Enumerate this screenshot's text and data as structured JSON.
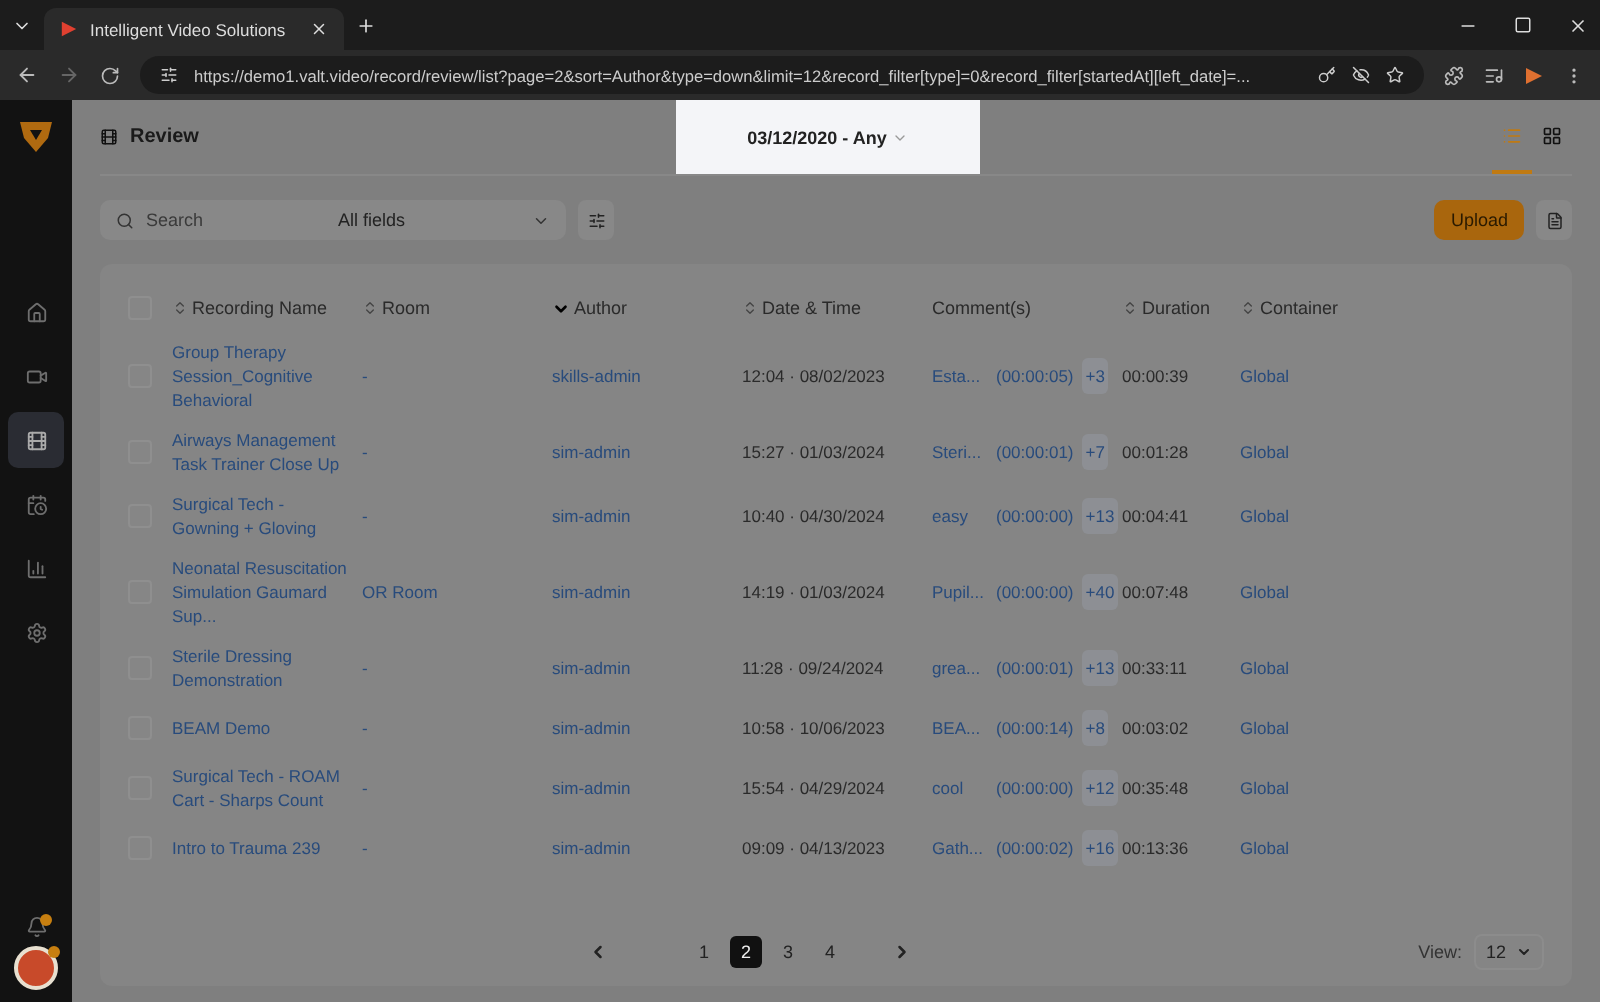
{
  "browser": {
    "tab_title": "Intelligent Video Solutions",
    "url": "https://demo1.valt.video/record/review/list?page=2&sort=Author&type=down&limit=12&record_filter[type]=0&record_filter[startedAt][left_date]=..."
  },
  "sidebar": {
    "items": [
      {
        "selected": false
      },
      {
        "selected": false
      },
      {
        "selected": true
      },
      {
        "selected": false
      },
      {
        "selected": false
      },
      {
        "selected": false
      }
    ],
    "notifications_unread": true,
    "avatar_badge": true
  },
  "header": {
    "title": "Review",
    "date_range": "03/12/2020 - Any",
    "view_buttons": [
      {
        "selected": true
      },
      {
        "selected": false
      }
    ]
  },
  "toolbar": {
    "search_placeholder": "Search",
    "field_select": "All fields",
    "upload": "Upload"
  },
  "table": {
    "select_all_checked": false,
    "columns": [
      {
        "label": "Recording Name",
        "sortable": true,
        "sorted": false
      },
      {
        "label": "Room",
        "sortable": true,
        "sorted": false
      },
      {
        "label": "Author",
        "sortable": true,
        "sorted": true
      },
      {
        "label": "Date & Time",
        "sortable": true,
        "sorted": false
      },
      {
        "label": "Comment(s)",
        "sortable": false,
        "sorted": false
      },
      {
        "label": "Duration",
        "sortable": true,
        "sorted": false
      },
      {
        "label": "Container",
        "sortable": true,
        "sorted": false
      }
    ],
    "rows": [
      {
        "checked": false,
        "name": "Group Therapy Session_Cognitive Behavioral",
        "room": "-",
        "author": "skills-admin",
        "datetime": "12:04 · 08/02/2023",
        "comment": "Esta...",
        "comment_time": "(00:00:05)",
        "more": "+3",
        "duration": "00:00:39",
        "container": "Global"
      },
      {
        "checked": false,
        "name": "Airways Management Task Trainer Close Up",
        "room": "-",
        "author": "sim-admin",
        "datetime": "15:27 · 01/03/2024",
        "comment": "Steri...",
        "comment_time": "(00:00:01)",
        "more": "+7",
        "duration": "00:01:28",
        "container": "Global"
      },
      {
        "checked": false,
        "name": "Surgical Tech - Gowning + Gloving",
        "room": "-",
        "author": "sim-admin",
        "datetime": "10:40 · 04/30/2024",
        "comment": "easy",
        "comment_time": "(00:00:00)",
        "more": "+13",
        "duration": "00:04:41",
        "container": "Global"
      },
      {
        "checked": false,
        "name": "Neonatal Resuscitation Simulation Gaumard Sup...",
        "room": "OR Room",
        "author": "sim-admin",
        "datetime": "14:19 · 01/03/2024",
        "comment": "Pupil...",
        "comment_time": "(00:00:00)",
        "more": "+40",
        "duration": "00:07:48",
        "container": "Global"
      },
      {
        "checked": false,
        "name": "Sterile Dressing Demonstration",
        "room": "-",
        "author": "sim-admin",
        "datetime": "11:28 · 09/24/2024",
        "comment": "grea...",
        "comment_time": "(00:00:01)",
        "more": "+13",
        "duration": "00:33:11",
        "container": "Global"
      },
      {
        "checked": false,
        "name": "BEAM Demo",
        "room": "-",
        "author": "sim-admin",
        "datetime": "10:58 · 10/06/2023",
        "comment": "BEA...",
        "comment_time": "(00:00:14)",
        "more": "+8",
        "duration": "00:03:02",
        "container": "Global"
      },
      {
        "checked": false,
        "name": "Surgical Tech - ROAM Cart - Sharps Count",
        "room": "-",
        "author": "sim-admin",
        "datetime": "15:54 · 04/29/2024",
        "comment": "cool",
        "comment_time": "(00:00:00)",
        "more": "+12",
        "duration": "00:35:48",
        "container": "Global"
      },
      {
        "checked": false,
        "name": "Intro to Trauma 239",
        "room": "-",
        "author": "sim-admin",
        "datetime": "09:09 · 04/13/2023",
        "comment": "Gath...",
        "comment_time": "(00:00:02)",
        "more": "+16",
        "duration": "00:13:36",
        "container": "Global"
      }
    ]
  },
  "pagination": {
    "pages": [
      {
        "label": "1",
        "selected": false
      },
      {
        "label": "2",
        "selected": true
      },
      {
        "label": "3",
        "selected": false
      },
      {
        "label": "4",
        "selected": false
      }
    ],
    "view_label": "View:",
    "view_value": "12"
  }
}
